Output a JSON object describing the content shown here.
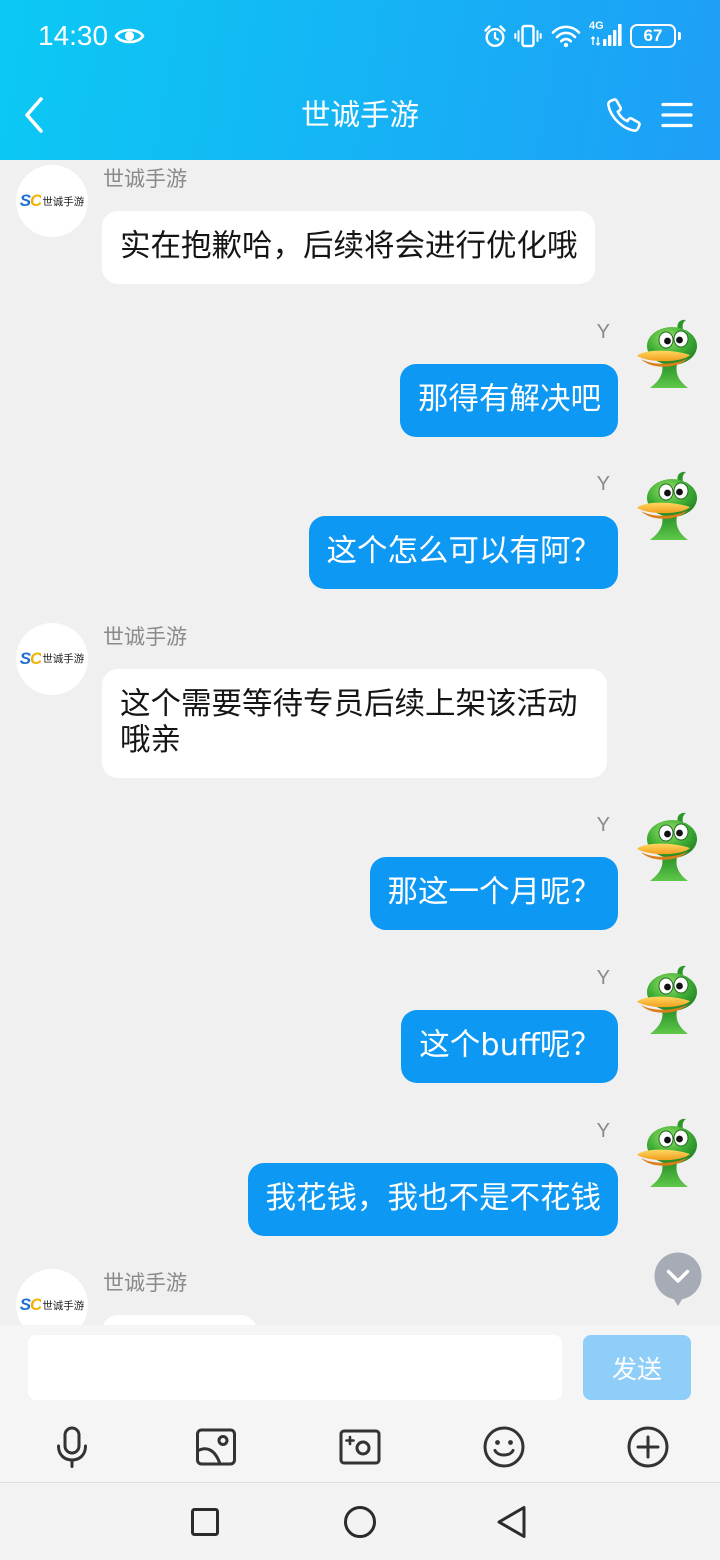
{
  "status_bar": {
    "time": "14:30",
    "network": "4G",
    "battery_level": "67",
    "icons": [
      "eye-icon",
      "alarm-icon",
      "vibrate-icon",
      "wifi-icon",
      "signal-icon",
      "battery-icon"
    ]
  },
  "header": {
    "title": "世诚手游",
    "icons": [
      "chevron-left-icon",
      "phone-icon",
      "menu-icon"
    ]
  },
  "contact_avatar": {
    "logo_mark": "SC",
    "logo_text": "世诚手游"
  },
  "user_avatar_icon": "green-duck-avatar-icon",
  "messages": [
    {
      "sender": "世诚手游",
      "text": "实在抱歉哈，后续将会进行优化哦"
    },
    {
      "sender": "Y",
      "text": "那得有解决吧"
    },
    {
      "sender": "Y",
      "text": "这个怎么可以有阿？"
    },
    {
      "sender": "世诚手游",
      "text": "这个需要等待专员后续上架该活动哦亲"
    },
    {
      "sender": "Y",
      "text": "那这一个月呢？"
    },
    {
      "sender": "Y",
      "text": "这个buff呢？"
    },
    {
      "sender": "Y",
      "text": "我花钱，我也不是不花钱"
    },
    {
      "sender": "世诚手游",
      "text": ""
    }
  ],
  "scroll_down_icon": "chevron-down-icon",
  "composer": {
    "input_value": "",
    "send_label": "发送"
  },
  "toolbar": {
    "icons": [
      "microphone-icon",
      "image-icon",
      "camera-icon",
      "emoji-icon",
      "plus-circle-icon"
    ]
  },
  "nav_bar": {
    "icons": [
      "recent-apps-icon",
      "home-icon",
      "back-icon"
    ]
  },
  "colors": {
    "header_gradient_start": "#0bc9f4",
    "header_gradient_end": "#1e9ef6",
    "chat_background": "#f0f0f0",
    "incoming_bubble": "#ffffff",
    "outgoing_bubble": "#0d98f3",
    "send_button_disabled": "#8fcef8",
    "scroll_button": "#a6abb6"
  }
}
